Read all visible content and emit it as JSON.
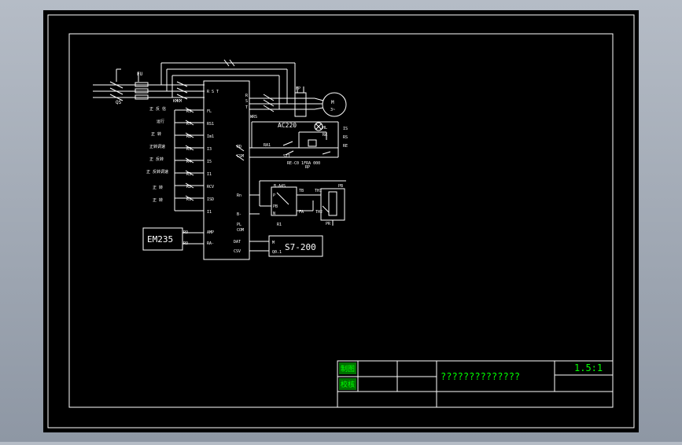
{
  "drawing": {
    "labels": {
      "qs": "QS",
      "fu": "FU",
      "km": "KM",
      "r1": "R1",
      "ac220": "AC220",
      "em235": "EM235",
      "s7_200": "S7-200",
      "m1": "M",
      "m2": "3~"
    },
    "title_block": {
      "row1_label": "制图",
      "row2_label": "校核",
      "drawing_name": "??????????????",
      "scale": "1.5:1"
    }
  },
  "colors": {
    "background": "#000000",
    "line": "#ffffff",
    "title_text": "#00ff00",
    "label_bg": "#00c000"
  }
}
